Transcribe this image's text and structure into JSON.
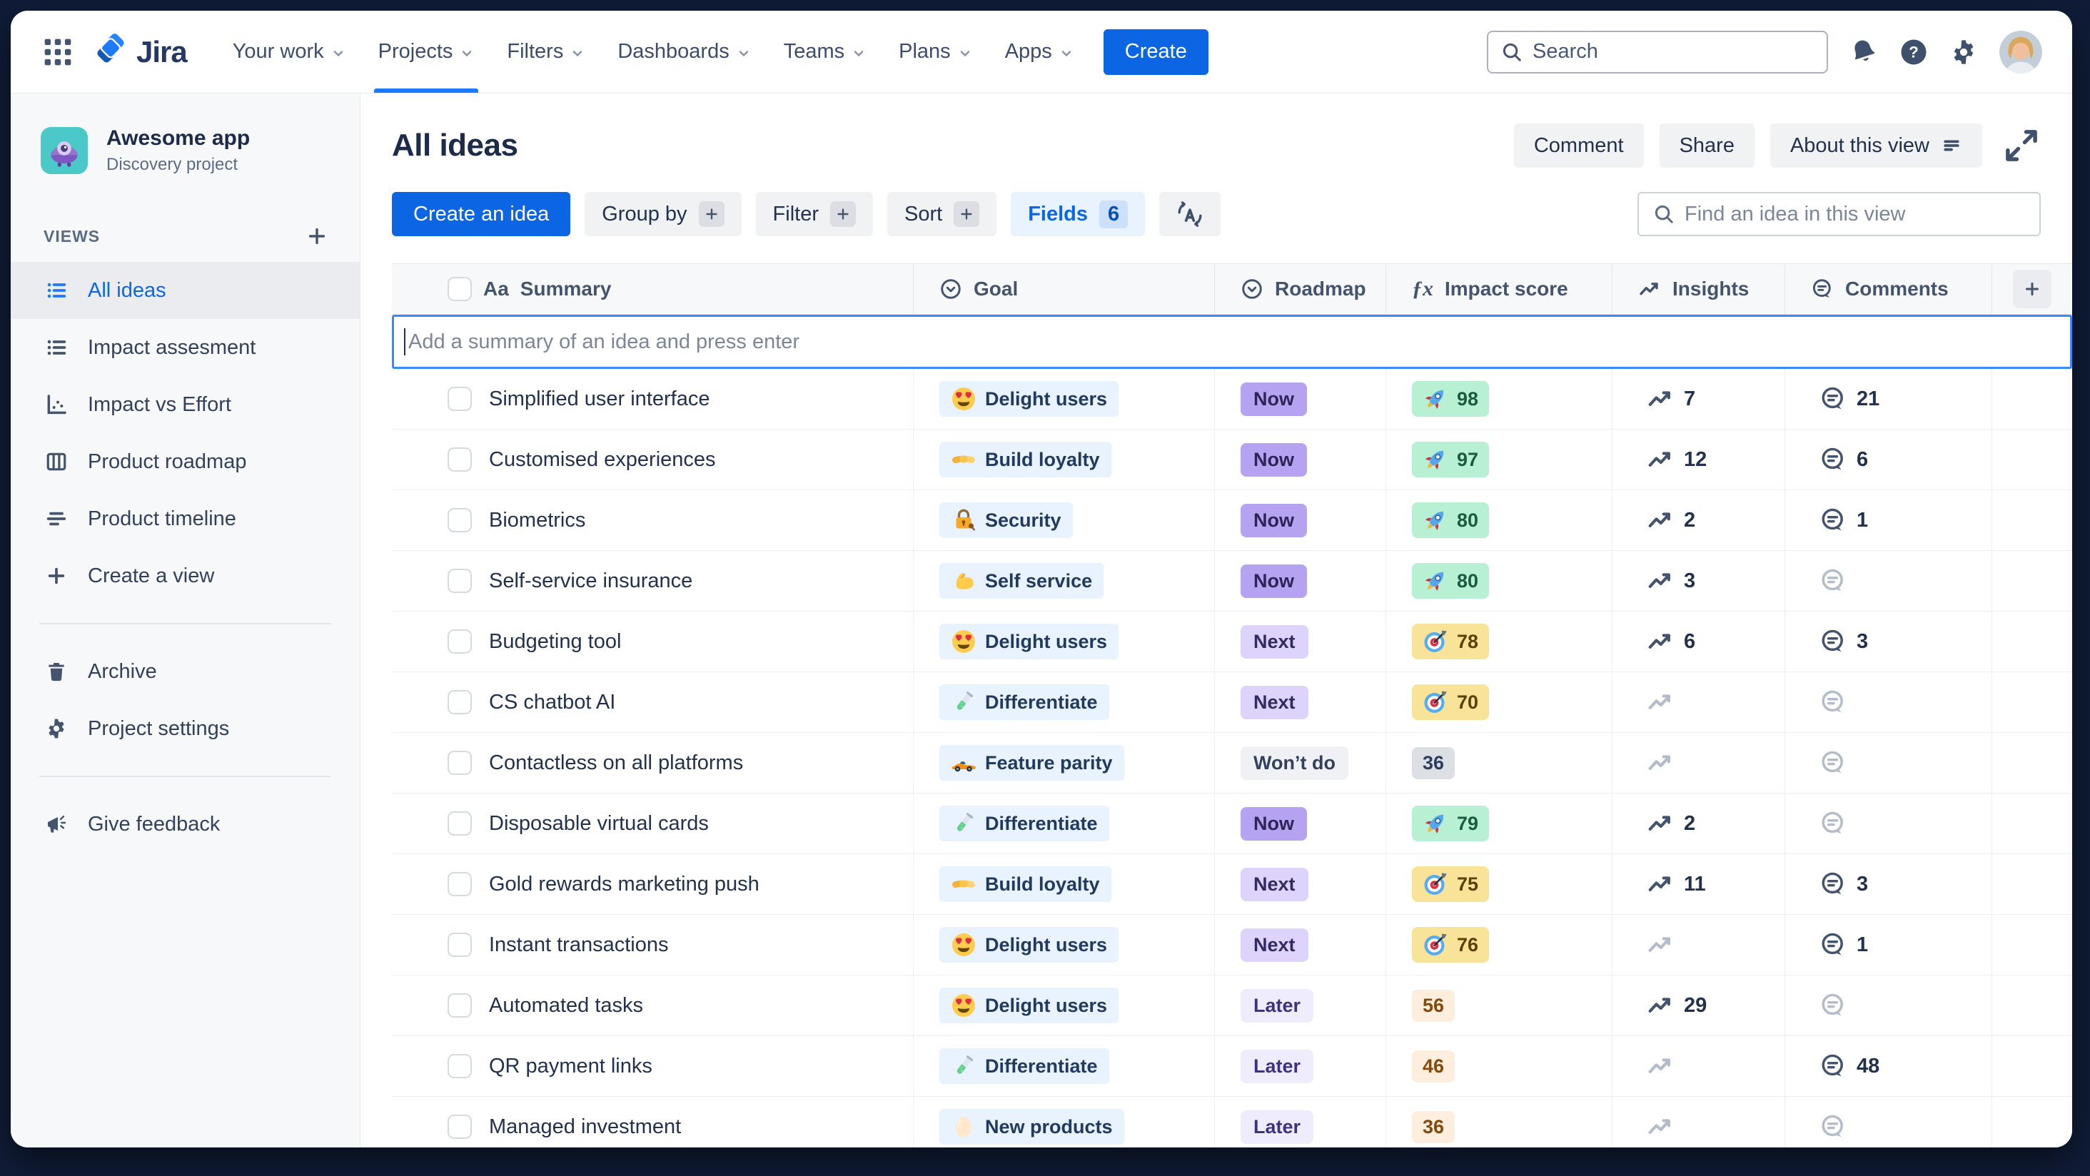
{
  "topbar": {
    "logo_text": "Jira",
    "nav_items": [
      {
        "label": "Your work"
      },
      {
        "label": "Projects",
        "active": true
      },
      {
        "label": "Filters"
      },
      {
        "label": "Dashboards"
      },
      {
        "label": "Teams"
      },
      {
        "label": "Plans"
      },
      {
        "label": "Apps"
      }
    ],
    "create_button": "Create",
    "search_placeholder": "Search"
  },
  "sidebar": {
    "project_name": "Awesome app",
    "project_type": "Discovery project",
    "views_label": "VIEWS",
    "views": [
      {
        "label": "All ideas",
        "icon": "list",
        "selected": true
      },
      {
        "label": "Impact assesment",
        "icon": "list"
      },
      {
        "label": "Impact vs Effort",
        "icon": "scatter"
      },
      {
        "label": "Product roadmap",
        "icon": "board"
      },
      {
        "label": "Product timeline",
        "icon": "timeline"
      },
      {
        "label": "Create a view",
        "icon": "plus"
      }
    ],
    "tools": [
      {
        "label": "Archive",
        "icon": "trash"
      },
      {
        "label": "Project settings",
        "icon": "gear"
      }
    ],
    "feedback_label": "Give feedback"
  },
  "view_header": {
    "title": "All ideas",
    "buttons": [
      "Comment",
      "Share",
      "About this view"
    ],
    "find_placeholder": "Find an idea in this view"
  },
  "toolbar": {
    "create_idea": "Create an idea",
    "group_by": "Group by",
    "filter": "Filter",
    "sort": "Sort",
    "fields": "Fields",
    "fields_count": "6"
  },
  "table": {
    "columns": [
      "Summary",
      "Goal",
      "Roadmap",
      "Impact score",
      "Insights",
      "Comments"
    ],
    "summary_type_glyph": "Aa",
    "impact_formula_glyph": "ƒx",
    "add_row_placeholder": "Add a summary of an idea and press enter",
    "rows": [
      {
        "summary": "Simplified user interface",
        "goal": {
          "label": "Delight users",
          "icon": "heart-eyes"
        },
        "roadmap": {
          "label": "Now",
          "tone": "now"
        },
        "impact": {
          "value": "98",
          "variant": "green",
          "icon": "rocket"
        },
        "insights": "7",
        "comments": "21"
      },
      {
        "summary": "Customised experiences",
        "goal": {
          "label": "Build loyalty",
          "icon": "handshake"
        },
        "roadmap": {
          "label": "Now",
          "tone": "now"
        },
        "impact": {
          "value": "97",
          "variant": "green",
          "icon": "rocket"
        },
        "insights": "12",
        "comments": "6"
      },
      {
        "summary": "Biometrics",
        "goal": {
          "label": "Security",
          "icon": "lock"
        },
        "roadmap": {
          "label": "Now",
          "tone": "now"
        },
        "impact": {
          "value": "80",
          "variant": "green",
          "icon": "rocket"
        },
        "insights": "2",
        "comments": "1"
      },
      {
        "summary": "Self-service insurance",
        "goal": {
          "label": "Self service",
          "icon": "biceps"
        },
        "roadmap": {
          "label": "Now",
          "tone": "now"
        },
        "impact": {
          "value": "80",
          "variant": "green",
          "icon": "rocket"
        },
        "insights": "3",
        "comments": null
      },
      {
        "summary": "Budgeting tool",
        "goal": {
          "label": "Delight users",
          "icon": "heart-eyes"
        },
        "roadmap": {
          "label": "Next",
          "tone": "next"
        },
        "impact": {
          "value": "78",
          "variant": "yellow",
          "icon": "dart"
        },
        "insights": "6",
        "comments": "3"
      },
      {
        "summary": "CS chatbot AI",
        "goal": {
          "label": "Differentiate",
          "icon": "test-tube"
        },
        "roadmap": {
          "label": "Next",
          "tone": "next"
        },
        "impact": {
          "value": "70",
          "variant": "yellow",
          "icon": "dart"
        },
        "insights": null,
        "comments": null
      },
      {
        "summary": "Contactless on all platforms",
        "goal": {
          "label": "Feature parity",
          "icon": "race-car"
        },
        "roadmap": {
          "label": "Won’t do",
          "tone": "wont"
        },
        "impact": {
          "value": "36",
          "variant": "gray",
          "icon": null
        },
        "insights": null,
        "comments": null
      },
      {
        "summary": "Disposable virtual cards",
        "goal": {
          "label": "Differentiate",
          "icon": "test-tube"
        },
        "roadmap": {
          "label": "Now",
          "tone": "now"
        },
        "impact": {
          "value": "79",
          "variant": "green",
          "icon": "rocket"
        },
        "insights": "2",
        "comments": null
      },
      {
        "summary": "Gold rewards marketing push",
        "goal": {
          "label": "Build loyalty",
          "icon": "handshake"
        },
        "roadmap": {
          "label": "Next",
          "tone": "next"
        },
        "impact": {
          "value": "75",
          "variant": "yellow",
          "icon": "dart"
        },
        "insights": "11",
        "comments": "3"
      },
      {
        "summary": "Instant transactions",
        "goal": {
          "label": "Delight users",
          "icon": "heart-eyes"
        },
        "roadmap": {
          "label": "Next",
          "tone": "next"
        },
        "impact": {
          "value": "76",
          "variant": "yellow",
          "icon": "dart"
        },
        "insights": null,
        "comments": "1"
      },
      {
        "summary": "Automated tasks",
        "goal": {
          "label": "Delight users",
          "icon": "heart-eyes"
        },
        "roadmap": {
          "label": "Later",
          "tone": "later"
        },
        "impact": {
          "value": "56",
          "variant": "peach",
          "icon": null
        },
        "insights": "29",
        "comments": null
      },
      {
        "summary": "QR payment links",
        "goal": {
          "label": "Differentiate",
          "icon": "test-tube"
        },
        "roadmap": {
          "label": "Later",
          "tone": "later"
        },
        "impact": {
          "value": "46",
          "variant": "peach",
          "icon": null
        },
        "insights": null,
        "comments": "48"
      },
      {
        "summary": "Managed investment",
        "goal": {
          "label": "New products",
          "icon": "egg"
        },
        "roadmap": {
          "label": "Later",
          "tone": "later"
        },
        "impact": {
          "value": "36",
          "variant": "peach",
          "icon": null
        },
        "insights": null,
        "comments": null
      }
    ]
  },
  "colors": {
    "accent_blue": "#0c66e4",
    "frame_background": "#101c38",
    "sidebar_background": "#f7f8f9",
    "goal_chip_bg": "#e9f2ff",
    "roadmap_now": "#b5a3f2",
    "roadmap_next": "#ddd3fb",
    "roadmap_later": "#efecfd",
    "roadmap_wont_do": "#f0f1f4",
    "impact_high_bg": "#b7f0d3",
    "impact_mid_bg": "#f8e399",
    "impact_low_bg": "#fdeedd",
    "impact_gray_bg": "#dcdfe4",
    "focus_border": "#388bff"
  }
}
